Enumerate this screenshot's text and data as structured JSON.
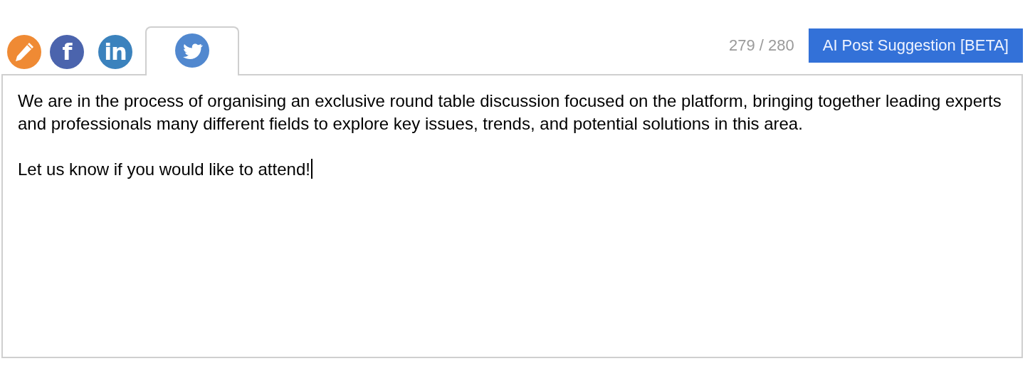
{
  "tabs": [
    {
      "kind": "edit",
      "selected": false
    },
    {
      "kind": "letter",
      "glyph": "f",
      "color": "#4b64ad",
      "selected": false
    },
    {
      "kind": "letter",
      "glyph": "in",
      "color": "#3b82bd",
      "selected": false
    },
    {
      "kind": "bird",
      "color": "#5188cf",
      "selected": true
    }
  ],
  "counter": "279 / 280",
  "suggest_button": "AI Post Suggestion [BETA]",
  "post_text": [
    "We are in the process of organising an exclusive round table discussion focused on the platform, bringing together leading experts and professionals many different fields to explore key issues, trends, and potential solutions in this area.",
    "Let us know if you would like to attend!"
  ]
}
